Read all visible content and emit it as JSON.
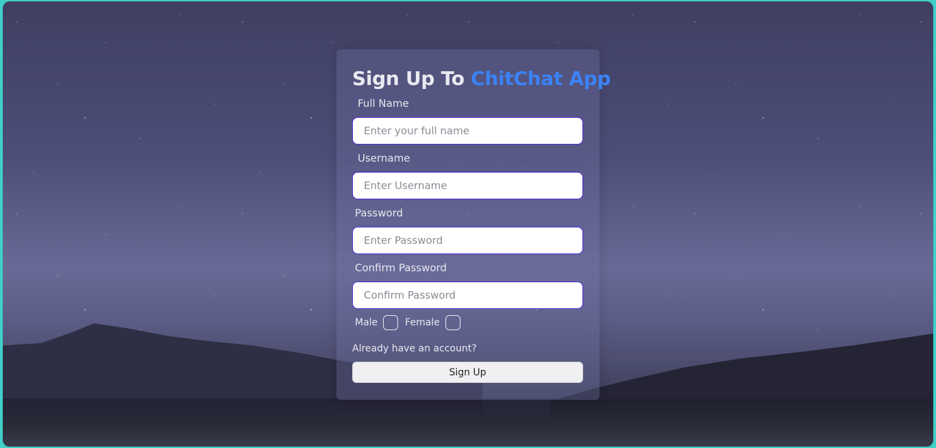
{
  "form": {
    "title_prefix": "Sign Up To",
    "title_brand": "ChitChat App",
    "accent_color": "#3b82f6",
    "fields": {
      "full_name": {
        "label": "Full Name",
        "placeholder": "Enter your full name",
        "value": ""
      },
      "username": {
        "label": "Username",
        "placeholder": "Enter Username",
        "value": ""
      },
      "password": {
        "label": "Password",
        "placeholder": "Enter Password",
        "value": ""
      },
      "confirm_password": {
        "label": "Confirm Password",
        "placeholder": "Confirm Password",
        "value": ""
      }
    },
    "gender": {
      "male_label": "Male",
      "female_label": "Female"
    },
    "login_link": "Already have an account?",
    "submit_label": "Sign Up"
  }
}
